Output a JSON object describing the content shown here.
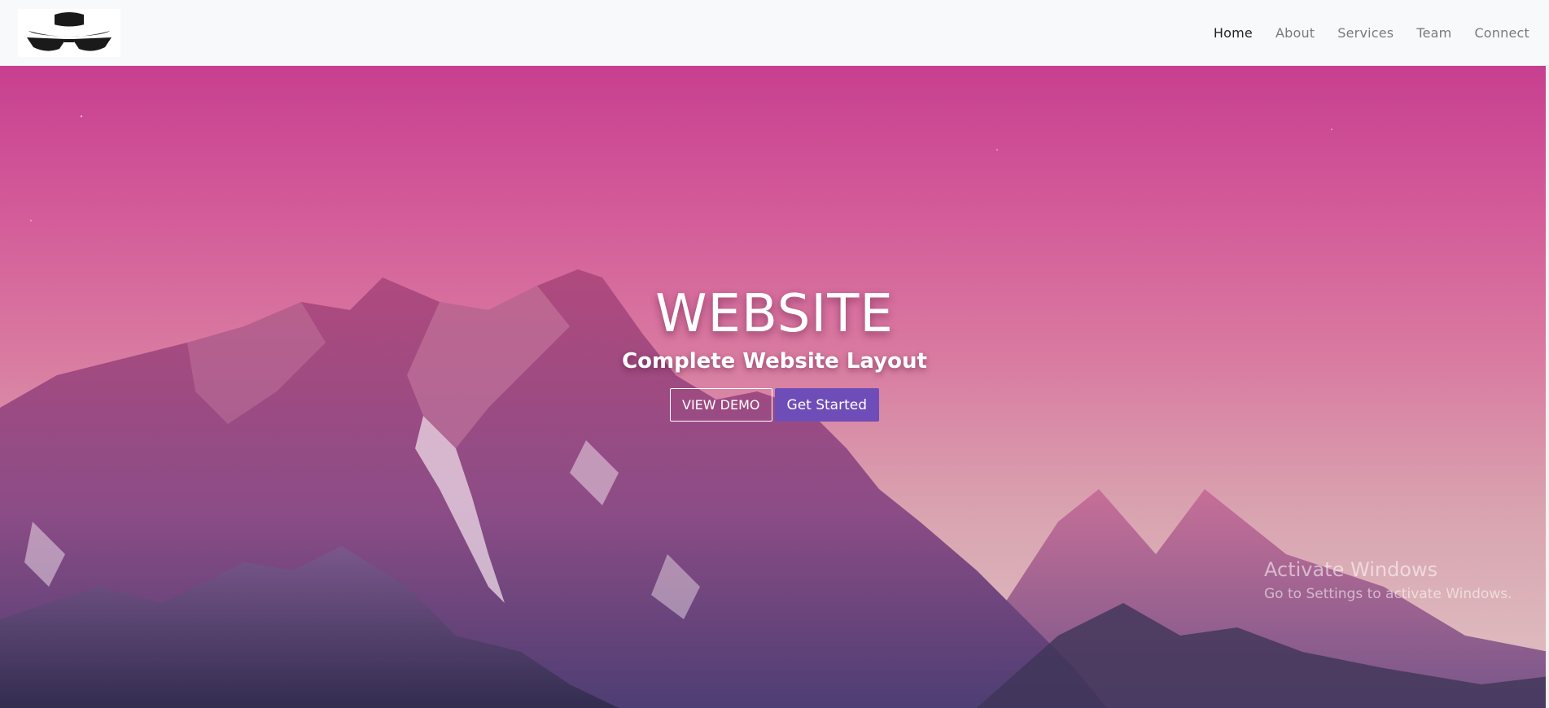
{
  "navbar": {
    "logo": "hat-and-glasses-logo",
    "links": [
      {
        "label": "Home",
        "active": true
      },
      {
        "label": "About",
        "active": false
      },
      {
        "label": "Services",
        "active": false
      },
      {
        "label": "Team",
        "active": false
      },
      {
        "label": "Connect",
        "active": false
      }
    ]
  },
  "hero": {
    "title": "WEBSITE",
    "subtitle": "Complete Website Layout",
    "buttons": {
      "demo_label": "VIEW DEMO",
      "start_label": "Get Started"
    },
    "colors": {
      "sky_top": "#c73f8f",
      "sky_bottom": "#dfc3c4",
      "primary_button": "#6f4db8"
    }
  },
  "watermark": {
    "title": "Activate Windows",
    "subtitle": "Go to Settings to activate Windows."
  }
}
